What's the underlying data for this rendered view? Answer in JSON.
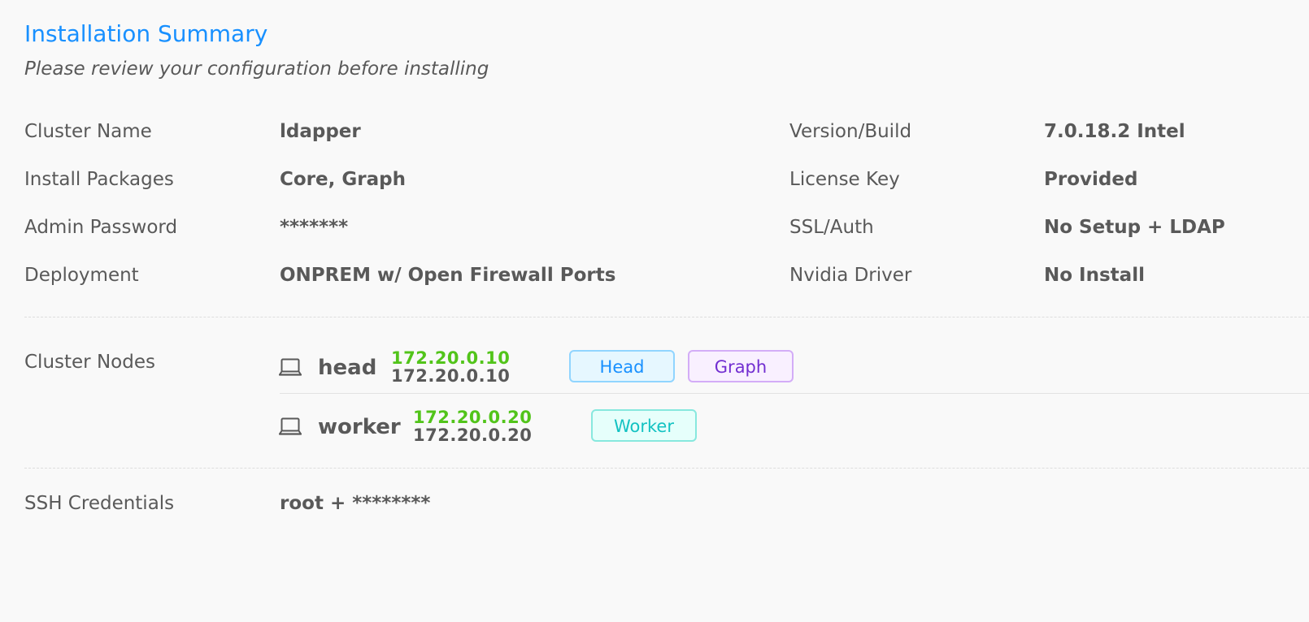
{
  "header": {
    "title": "Installation Summary",
    "subtitle": "Please review your configuration before installing"
  },
  "summary": {
    "left": [
      {
        "label": "Cluster Name",
        "value": "ldapper"
      },
      {
        "label": "Install Packages",
        "value": "Core, Graph"
      },
      {
        "label": "Admin Password",
        "value": "*******"
      },
      {
        "label": "Deployment",
        "value": "ONPREM w/ Open Firewall Ports"
      }
    ],
    "right": [
      {
        "label": "Version/Build",
        "value": "7.0.18.2 Intel"
      },
      {
        "label": "License Key",
        "value": "Provided"
      },
      {
        "label": "SSL/Auth",
        "value": "No Setup + LDAP"
      },
      {
        "label": "Nvidia Driver",
        "value": "No Install"
      }
    ]
  },
  "cluster_nodes": {
    "label": "Cluster Nodes",
    "nodes": [
      {
        "icon": "laptop-icon",
        "name": "head",
        "public_ip": "172.20.0.10",
        "private_ip": "172.20.0.10",
        "tags": [
          {
            "label": "Head",
            "color": "#1890ff"
          },
          {
            "label": "Graph",
            "color": "#722ed1"
          }
        ]
      },
      {
        "icon": "laptop-icon",
        "name": "worker",
        "public_ip": "172.20.0.20",
        "private_ip": "172.20.0.20",
        "tags": [
          {
            "label": "Worker",
            "color": "#13c2c2"
          }
        ]
      }
    ]
  },
  "ssh": {
    "label": "SSH Credentials",
    "value": "root + ********"
  },
  "colors": {
    "accent": "#1890ff",
    "ip_primary": "#52c41a",
    "text": "#595959"
  }
}
